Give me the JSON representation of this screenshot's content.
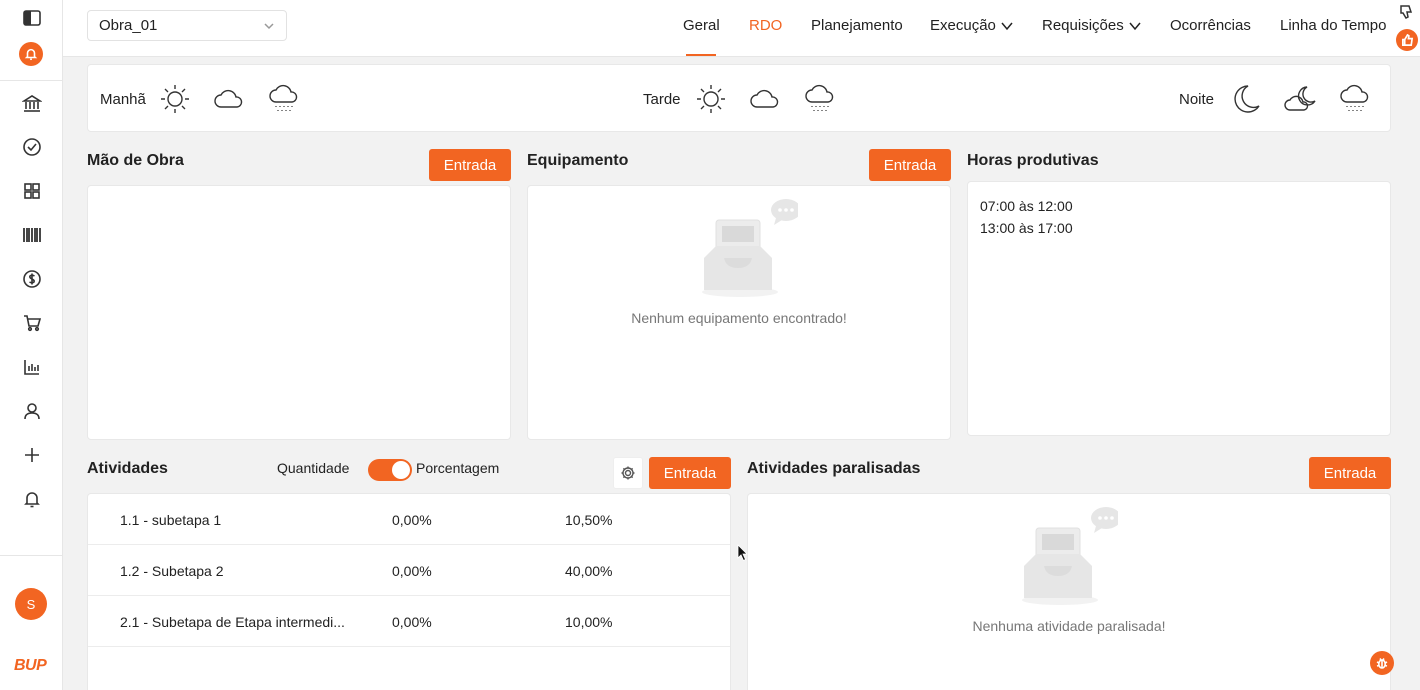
{
  "colors": {
    "accent": "#f26522"
  },
  "sidebar": {
    "icons": [
      "panel-toggle-icon",
      "notification-bell-icon",
      "bank-icon",
      "check-circle-icon",
      "grid-icon",
      "barcode-icon",
      "dollar-icon",
      "cart-icon",
      "bar-chart-icon",
      "user-icon",
      "plus-icon",
      "bell-icon"
    ],
    "avatar_initial": "S",
    "brand": "BUP"
  },
  "topbar": {
    "project": "Obra_01",
    "tabs": [
      {
        "label": "Geral"
      },
      {
        "label": "RDO",
        "active": true
      },
      {
        "label": "Planejamento"
      },
      {
        "label": "Execução",
        "dropdown": true
      },
      {
        "label": "Requisições",
        "dropdown": true
      },
      {
        "label": "Ocorrências"
      },
      {
        "label": "Linha do Tempo"
      }
    ]
  },
  "weather": {
    "morning": "Manhã",
    "afternoon": "Tarde",
    "night": "Noite"
  },
  "labor": {
    "title": "Mão de Obra",
    "button": "Entrada"
  },
  "equipment": {
    "title": "Equipamento",
    "button": "Entrada",
    "empty": "Nenhum equipamento encontrado!"
  },
  "hours": {
    "title": "Horas produtivas",
    "entries": [
      "07:00 às 12:00",
      "13:00 às 17:00"
    ]
  },
  "activities": {
    "title": "Atividades",
    "toggle_left": "Quantidade",
    "toggle_right": "Porcentagem",
    "button": "Entrada",
    "rows": [
      {
        "name": "1.1 - subetapa 1",
        "col1": "0,00%",
        "col2": "10,50%"
      },
      {
        "name": "1.2 - Subetapa 2",
        "col1": "0,00%",
        "col2": "40,00%"
      },
      {
        "name": "2.1 - Subetapa de Etapa intermedi...",
        "col1": "0,00%",
        "col2": "10,00%"
      }
    ]
  },
  "paused": {
    "title": "Atividades paralisadas",
    "button": "Entrada",
    "empty": "Nenhuma atividade paralisada!"
  }
}
